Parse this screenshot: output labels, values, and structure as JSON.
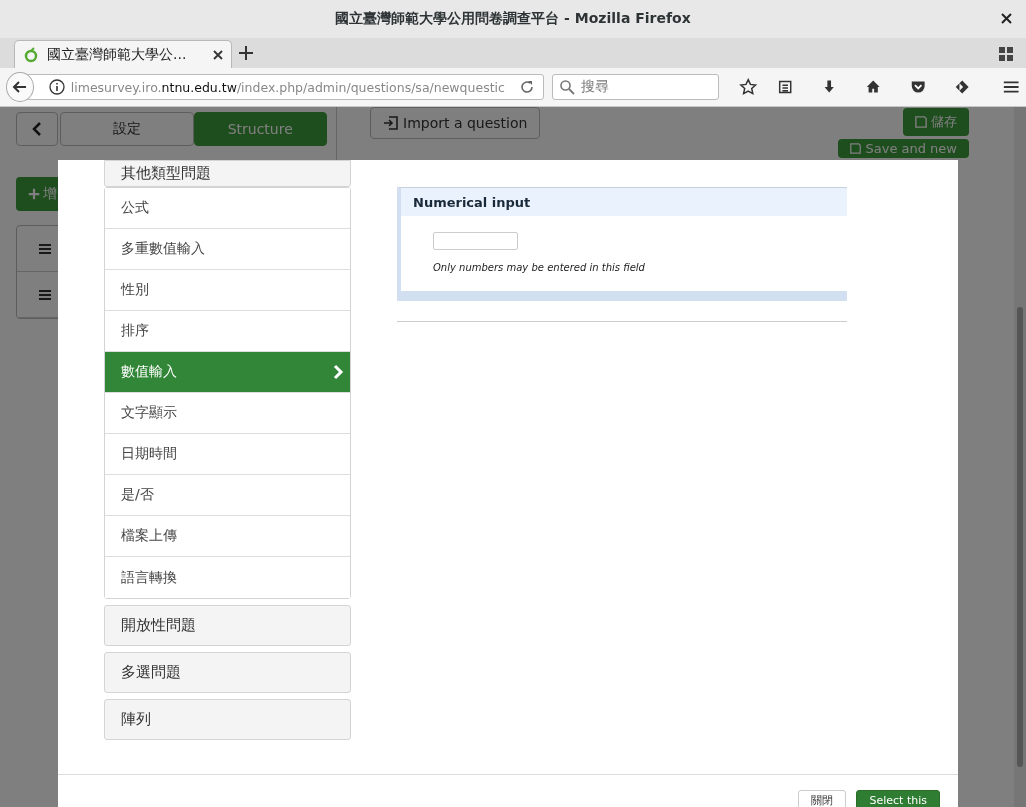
{
  "window": {
    "title": "國立臺灣師範大學公用問卷調查平台 - Mozilla Firefox"
  },
  "browser": {
    "tab_title": "國立臺灣師範大學公...",
    "url": {
      "prefix": "limesurvey.iro.",
      "domain": "ntnu.edu.tw",
      "path": "/index.php/admin/questions/sa/newquestic"
    },
    "search": {
      "placeholder": "搜尋"
    }
  },
  "background": {
    "tabs": [
      {
        "label": "設定",
        "selected": false
      },
      {
        "label": "Structure",
        "selected": true
      }
    ],
    "add_button": "增",
    "import_button": "Import a question",
    "save_button": "儲存",
    "save_new_button": "Save and new"
  },
  "modal": {
    "groups": [
      {
        "label": "其他類型問題",
        "items": [
          {
            "label": "公式",
            "selected": false
          },
          {
            "label": "多重數值輸入",
            "selected": false
          },
          {
            "label": "性別",
            "selected": false
          },
          {
            "label": "排序",
            "selected": false
          },
          {
            "label": "數值輸入",
            "selected": true
          },
          {
            "label": "文字顯示",
            "selected": false
          },
          {
            "label": "日期時間",
            "selected": false
          },
          {
            "label": "是/否",
            "selected": false
          },
          {
            "label": "檔案上傳",
            "selected": false
          },
          {
            "label": "語言轉換",
            "selected": false
          }
        ]
      },
      {
        "label": "開放性問題"
      },
      {
        "label": "多選問題"
      },
      {
        "label": "陣列"
      }
    ],
    "preview": {
      "title": "Numerical input",
      "hint": "Only numbers may be entered in this field"
    },
    "buttons": {
      "close": "關閉",
      "select": "Select this"
    }
  }
}
